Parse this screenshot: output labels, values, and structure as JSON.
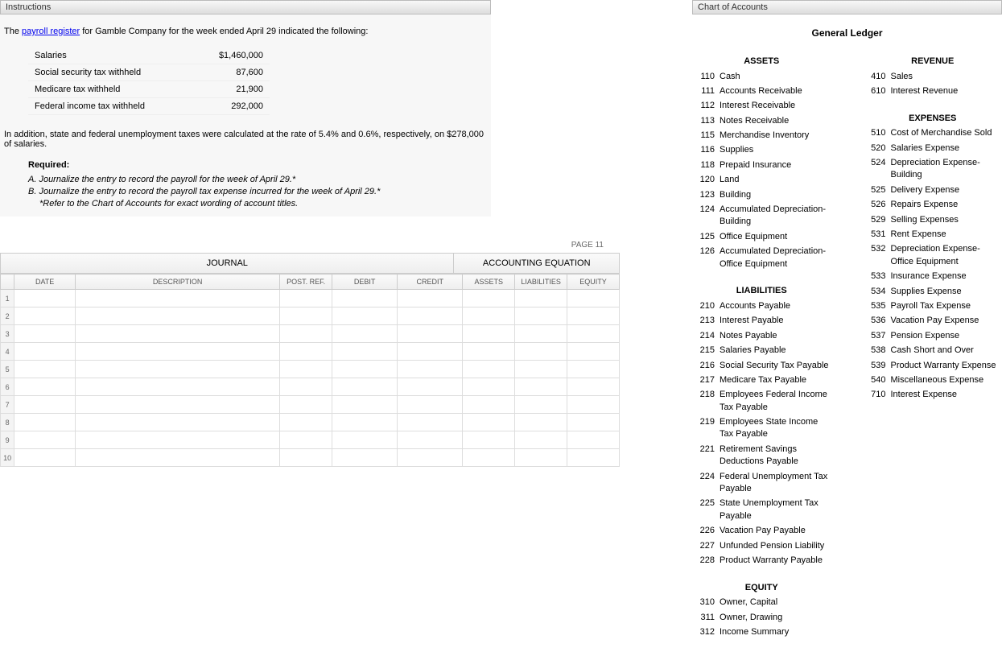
{
  "leftHeader": "Instructions",
  "rightHeader": "Chart of Accounts",
  "intro": {
    "prefix": "The ",
    "link": "payroll register",
    "suffix": " for Gamble Company for the week ended April 29 indicated the following:"
  },
  "payrollData": [
    {
      "label": "Salaries",
      "value": "$1,460,000"
    },
    {
      "label": "Social security tax withheld",
      "value": "87,600"
    },
    {
      "label": "Medicare tax withheld",
      "value": "21,900"
    },
    {
      "label": "Federal income tax withheld",
      "value": "292,000"
    }
  ],
  "additionalText": "In addition, state and federal unemployment taxes were calculated at the rate of 5.4% and 0.6%, respectively, on $278,000 of salaries.",
  "requiredLabel": "Required:",
  "requirements": [
    "A.  Journalize the entry to record the payroll for the week of April 29.*",
    "B.  Journalize the entry to record the payroll tax expense incurred for the week of April 29.*"
  ],
  "requirementNote": "*Refer to the Chart of Accounts for exact wording of account titles.",
  "pageLabel": "PAGE 11",
  "journalHeader": "JOURNAL",
  "equationHeader": "ACCOUNTING EQUATION",
  "journalCols": {
    "date": "DATE",
    "desc": "DESCRIPTION",
    "post": "POST. REF.",
    "debit": "DEBIT",
    "credit": "CREDIT",
    "assets": "ASSETS",
    "liab": "LIABILITIES",
    "equity": "EQUITY"
  },
  "journalRows": 10,
  "coaTitle": "General Ledger",
  "coa": {
    "assets": {
      "heading": "ASSETS",
      "items": [
        {
          "num": "110",
          "name": "Cash"
        },
        {
          "num": "111",
          "name": "Accounts Receivable"
        },
        {
          "num": "112",
          "name": "Interest Receivable"
        },
        {
          "num": "113",
          "name": "Notes Receivable"
        },
        {
          "num": "115",
          "name": "Merchandise Inventory"
        },
        {
          "num": "116",
          "name": "Supplies"
        },
        {
          "num": "118",
          "name": "Prepaid Insurance"
        },
        {
          "num": "120",
          "name": "Land"
        },
        {
          "num": "123",
          "name": "Building"
        },
        {
          "num": "124",
          "name": "Accumulated Depreciation-Building"
        },
        {
          "num": "125",
          "name": "Office Equipment"
        },
        {
          "num": "126",
          "name": "Accumulated Depreciation-Office Equipment"
        }
      ]
    },
    "liabilities": {
      "heading": "LIABILITIES",
      "items": [
        {
          "num": "210",
          "name": "Accounts Payable"
        },
        {
          "num": "213",
          "name": "Interest Payable"
        },
        {
          "num": "214",
          "name": "Notes Payable"
        },
        {
          "num": "215",
          "name": "Salaries Payable"
        },
        {
          "num": "216",
          "name": "Social Security Tax Payable"
        },
        {
          "num": "217",
          "name": "Medicare Tax Payable"
        },
        {
          "num": "218",
          "name": "Employees Federal Income Tax Payable"
        },
        {
          "num": "219",
          "name": "Employees State Income Tax Payable"
        },
        {
          "num": "221",
          "name": "Retirement Savings Deductions Payable"
        },
        {
          "num": "224",
          "name": "Federal Unemployment Tax Payable"
        },
        {
          "num": "225",
          "name": "State Unemployment Tax Payable"
        },
        {
          "num": "226",
          "name": "Vacation Pay Payable"
        },
        {
          "num": "227",
          "name": "Unfunded Pension Liability"
        },
        {
          "num": "228",
          "name": "Product Warranty Payable"
        }
      ]
    },
    "equity": {
      "heading": "EQUITY",
      "items": [
        {
          "num": "310",
          "name": "Owner, Capital"
        },
        {
          "num": "311",
          "name": "Owner, Drawing"
        },
        {
          "num": "312",
          "name": "Income Summary"
        }
      ]
    },
    "revenue": {
      "heading": "REVENUE",
      "items": [
        {
          "num": "410",
          "name": "Sales"
        },
        {
          "num": "610",
          "name": "Interest Revenue"
        }
      ]
    },
    "expenses": {
      "heading": "EXPENSES",
      "items": [
        {
          "num": "510",
          "name": "Cost of Merchandise Sold"
        },
        {
          "num": "520",
          "name": "Salaries Expense"
        },
        {
          "num": "524",
          "name": "Depreciation Expense-Building"
        },
        {
          "num": "525",
          "name": "Delivery Expense"
        },
        {
          "num": "526",
          "name": "Repairs Expense"
        },
        {
          "num": "529",
          "name": "Selling Expenses"
        },
        {
          "num": "531",
          "name": "Rent Expense"
        },
        {
          "num": "532",
          "name": "Depreciation Expense-Office Equipment"
        },
        {
          "num": "533",
          "name": "Insurance Expense"
        },
        {
          "num": "534",
          "name": "Supplies Expense"
        },
        {
          "num": "535",
          "name": "Payroll Tax Expense"
        },
        {
          "num": "536",
          "name": "Vacation Pay Expense"
        },
        {
          "num": "537",
          "name": "Pension Expense"
        },
        {
          "num": "538",
          "name": "Cash Short and Over"
        },
        {
          "num": "539",
          "name": "Product Warranty Expense"
        },
        {
          "num": "540",
          "name": "Miscellaneous Expense"
        },
        {
          "num": "710",
          "name": "Interest Expense"
        }
      ]
    }
  }
}
